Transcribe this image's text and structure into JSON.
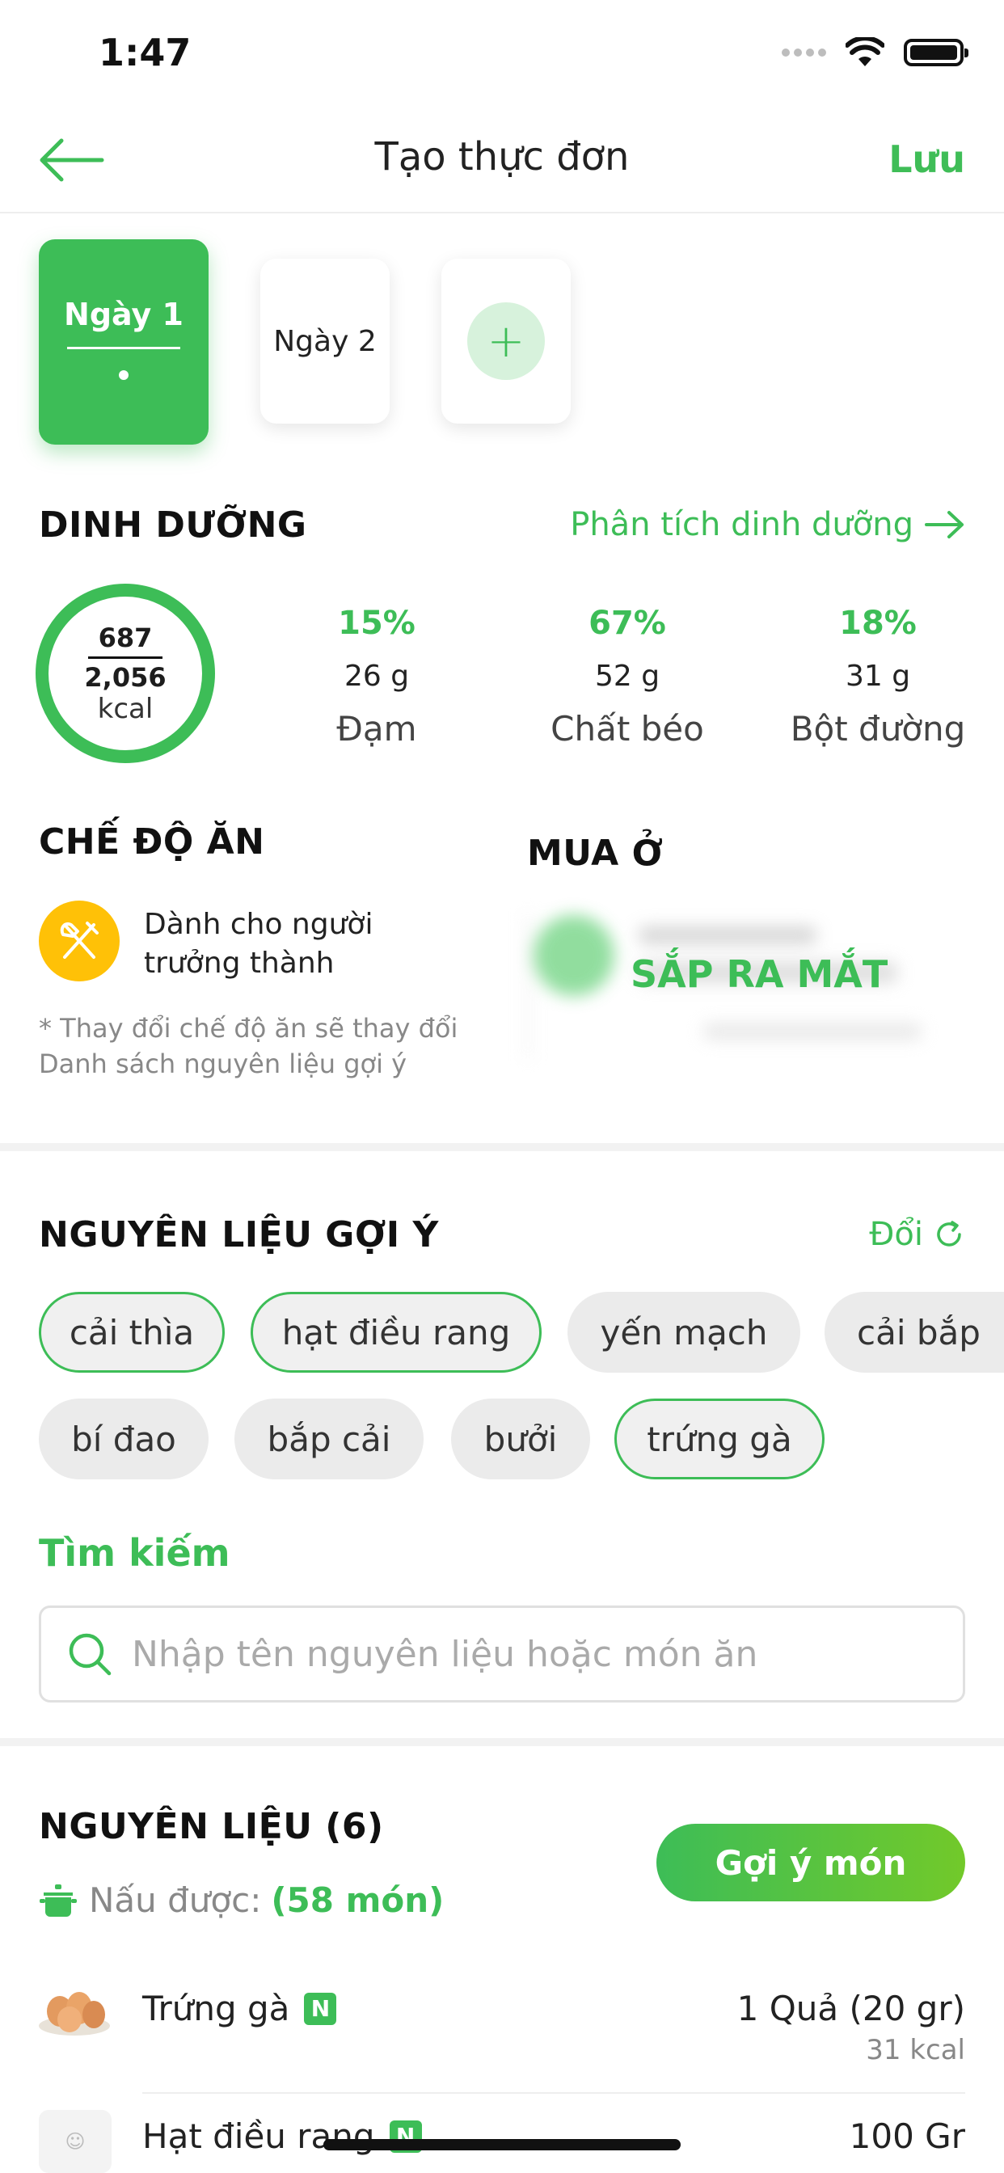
{
  "status_bar": {
    "time": "1:47",
    "icons": [
      "signal-icon",
      "wifi-icon",
      "battery-icon"
    ]
  },
  "nav": {
    "title": "Tạo thực đơn",
    "save_label": "Lưu",
    "back_icon": "arrow-left-icon"
  },
  "days": {
    "tabs": [
      {
        "label": "Ngày 1",
        "active": true
      },
      {
        "label": "Ngày 2",
        "active": false
      }
    ],
    "add_icon": "plus-icon"
  },
  "nutrition": {
    "title": "DINH DƯỠNG",
    "analysis_link": "Phân tích dinh dưỡng",
    "kcal_consumed": "687",
    "kcal_target": "2,056",
    "kcal_unit": "kcal",
    "macros": [
      {
        "percent": "15%",
        "grams": "26 g",
        "name": "Đạm"
      },
      {
        "percent": "67%",
        "grams": "52 g",
        "name": "Chất béo"
      },
      {
        "percent": "18%",
        "grams": "31 g",
        "name": "Bột đường"
      }
    ]
  },
  "diet": {
    "title": "CHẾ ĐỘ ĂN",
    "line1": "Dành cho người",
    "line2": "trưởng thành",
    "note1": "* Thay đổi chế độ ăn sẽ thay đổi",
    "note2": "Danh sách nguyên liệu gợi ý",
    "icon": "fork-knife-icon"
  },
  "buy": {
    "title": "MUA Ở",
    "coming_soon": "SẮP RA MẮT"
  },
  "suggested": {
    "title": "NGUYÊN LIỆU GỢI Ý",
    "change_label": "Đổi",
    "chips": [
      {
        "label": "cải thìa",
        "selected": true
      },
      {
        "label": "hạt điều rang",
        "selected": true
      },
      {
        "label": "yến mạch",
        "selected": false
      },
      {
        "label": "cải bắp",
        "selected": false
      },
      {
        "label": "bí đao",
        "selected": false
      },
      {
        "label": "bắp cải",
        "selected": false
      },
      {
        "label": "bưởi",
        "selected": false
      },
      {
        "label": "trứng gà",
        "selected": true
      }
    ]
  },
  "search": {
    "label": "Tìm kiếm",
    "placeholder": "Nhập tên nguyên liệu hoặc món ăn"
  },
  "ingredients": {
    "title": "NGUYÊN LIỆU (6)",
    "cook_label": "Nấu được:",
    "cook_count": "(58 món)",
    "suggest_button": "Gợi ý món",
    "items": [
      {
        "name": "Trứng gà",
        "badge": "N",
        "qty": "1 Quả (20 gr)",
        "kcal": "31 kcal"
      },
      {
        "name": "Hạt điều rang",
        "badge": "N",
        "qty": "100 Gr",
        "kcal": ""
      }
    ]
  }
}
